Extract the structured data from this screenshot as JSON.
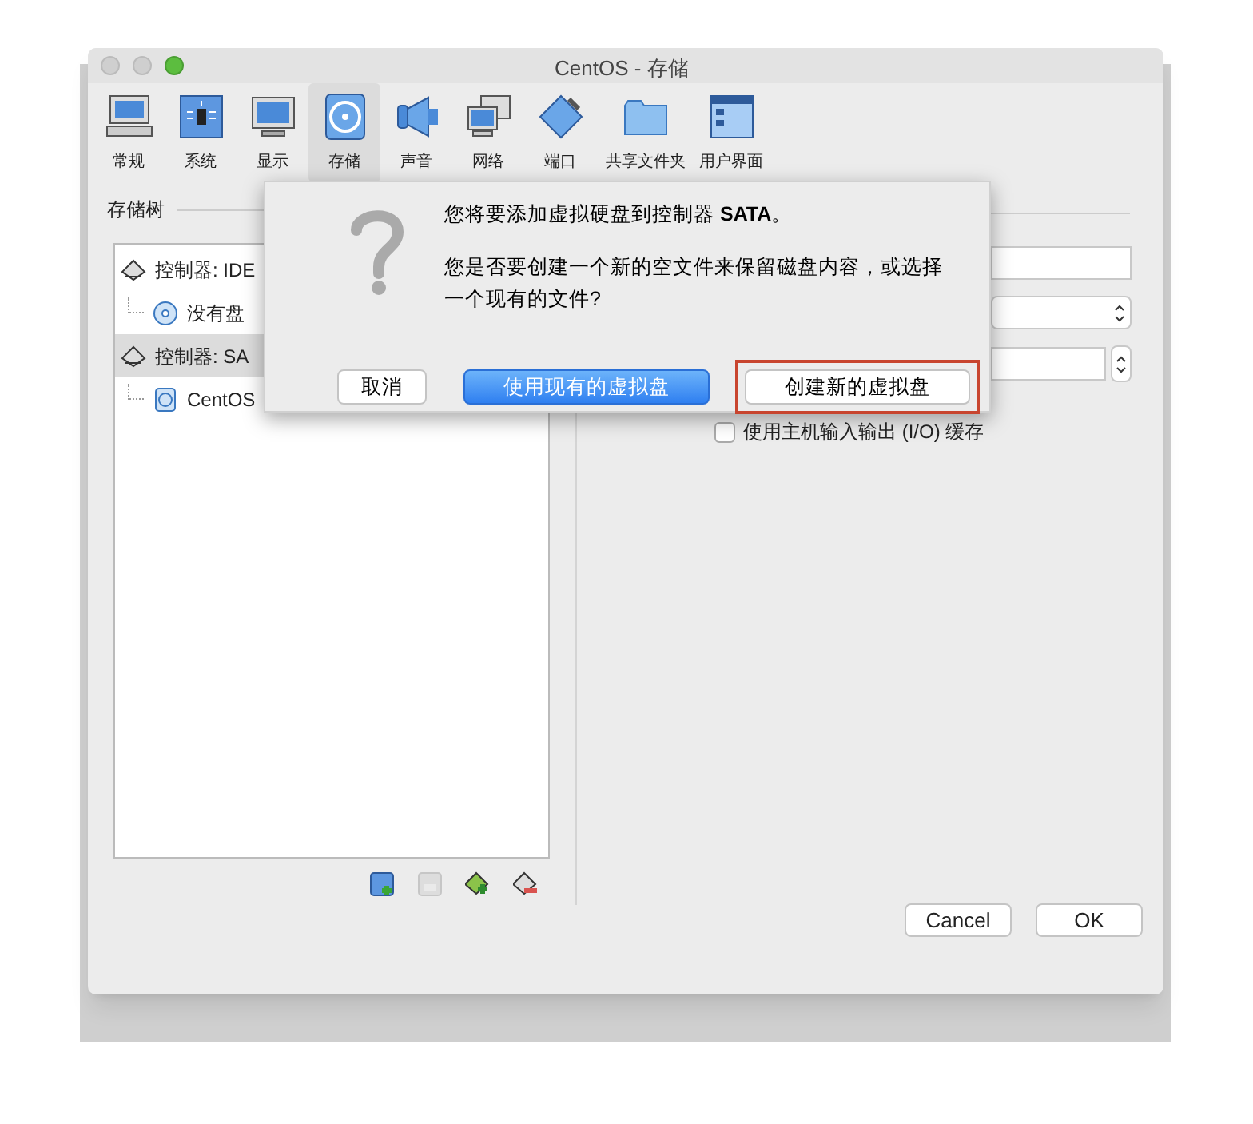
{
  "window": {
    "title": "CentOS - 存储"
  },
  "toolbar": [
    {
      "label": "常规",
      "kind": "general",
      "selected": false
    },
    {
      "label": "系统",
      "kind": "system",
      "selected": false
    },
    {
      "label": "显示",
      "kind": "display",
      "selected": false
    },
    {
      "label": "存储",
      "kind": "storage",
      "selected": true
    },
    {
      "label": "声音",
      "kind": "audio",
      "selected": false
    },
    {
      "label": "网络",
      "kind": "network",
      "selected": false
    },
    {
      "label": "端口",
      "kind": "ports",
      "selected": false
    },
    {
      "label": "共享文件夹",
      "kind": "shared_folders",
      "selected": false
    },
    {
      "label": "用户界面",
      "kind": "user_interface",
      "selected": false
    }
  ],
  "storage_tree": {
    "title": "存储树",
    "items": [
      {
        "label": "控制器: IDE",
        "kind": "controller",
        "selected": false,
        "children": [
          {
            "label": "没有盘",
            "kind": "optical",
            "selected": false
          }
        ]
      },
      {
        "label": "控制器: SA",
        "kind": "controller",
        "selected": true,
        "children": [
          {
            "label": "CentOS",
            "kind": "disk",
            "selected": false
          }
        ]
      }
    ]
  },
  "tree_actions": [
    {
      "kind": "add_attachment",
      "disabled": false
    },
    {
      "kind": "remove_attachment",
      "disabled": true
    },
    {
      "kind": "add_controller",
      "disabled": false
    },
    {
      "kind": "remove_controller",
      "disabled": false
    }
  ],
  "attributes": {
    "cache_checkbox": {
      "label": "使用主机输入输出 (I/O) 缓存",
      "checked": false
    }
  },
  "dialog": {
    "title": "您将要添加虚拟硬盘到控制器 **SATA**。",
    "message": "您是否要创建一个新的空文件来保留磁盘内容，或选择一个现有的文件?",
    "buttons": [
      {
        "label": "取消",
        "kind": "plain",
        "highlighted": false
      },
      {
        "label": "使用现有的虚拟盘",
        "kind": "default",
        "highlighted": false
      },
      {
        "label": "创建新的虚拟盘",
        "kind": "plain",
        "highlighted": true
      }
    ]
  },
  "buttons": [
    {
      "label": "Cancel"
    },
    {
      "label": "OK"
    }
  ]
}
